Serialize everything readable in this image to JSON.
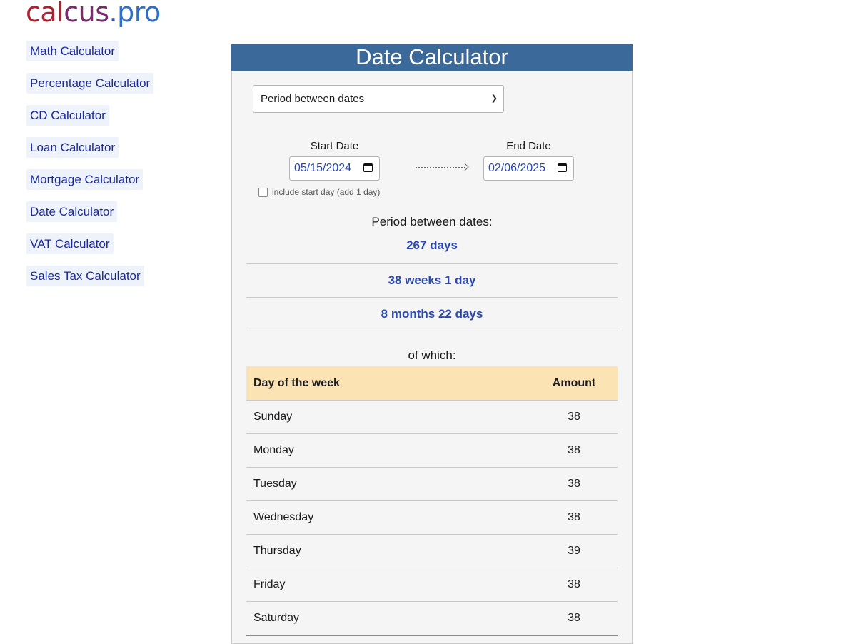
{
  "logo": {
    "part1": "cal",
    "part2": "cus",
    "part3": ".",
    "part4": "pro"
  },
  "sidebar": {
    "items": [
      {
        "label": "Math Calculator"
      },
      {
        "label": "Percentage Calculator"
      },
      {
        "label": "CD Calculator"
      },
      {
        "label": "Loan Calculator"
      },
      {
        "label": "Mortgage Calculator"
      },
      {
        "label": "Date Calculator"
      },
      {
        "label": "VAT Calculator"
      },
      {
        "label": "Sales Tax Calculator"
      }
    ]
  },
  "calculator": {
    "title": "Date Calculator",
    "mode": "Period between dates",
    "start_label": "Start Date",
    "start_value": "05/15/2024",
    "end_label": "End Date",
    "end_value": "02/06/2025",
    "include_label": "include start day (add 1 day)",
    "include_checked": false,
    "result_title": "Period between dates:",
    "results": [
      "267 days",
      "38 weeks 1 day",
      "8 months 22 days"
    ],
    "of_which": "of which:",
    "table": {
      "col_day": "Day of the week",
      "col_amount": "Amount",
      "rows": [
        {
          "day": "Sunday",
          "amount": "38"
        },
        {
          "day": "Monday",
          "amount": "38"
        },
        {
          "day": "Tuesday",
          "amount": "38"
        },
        {
          "day": "Wednesday",
          "amount": "38"
        },
        {
          "day": "Thursday",
          "amount": "39"
        },
        {
          "day": "Friday",
          "amount": "38"
        },
        {
          "day": "Saturday",
          "amount": "38"
        }
      ]
    }
  },
  "colors": {
    "header": "#3b6a9a",
    "link": "#1a2a9c",
    "result": "#2a48ad",
    "table_header": "#fce3b4"
  }
}
